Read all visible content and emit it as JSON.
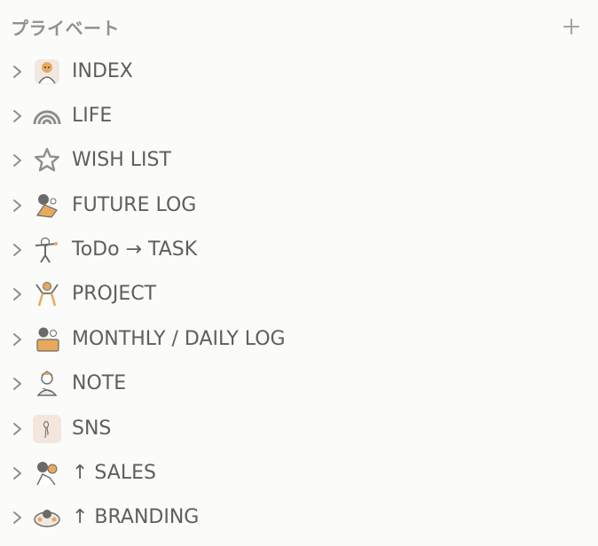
{
  "section": {
    "title": "プライベート",
    "add_icon": "plus-icon"
  },
  "pages": [
    {
      "label": "INDEX",
      "icon": "character-sticker-icon"
    },
    {
      "label": "LIFE",
      "icon": "rainbow-icon"
    },
    {
      "label": "WISH LIST",
      "icon": "star-outline-icon"
    },
    {
      "label": "FUTURE LOG",
      "icon": "character-sticker-icon"
    },
    {
      "label": "ToDo → TASK",
      "icon": "character-sticker-icon"
    },
    {
      "label": "PROJECT",
      "icon": "character-sticker-icon"
    },
    {
      "label": "MONTHLY / DAILY LOG",
      "icon": "character-sticker-icon"
    },
    {
      "label": "NOTE",
      "icon": "character-sticker-icon"
    },
    {
      "label": "SNS",
      "icon": "sketch-card-icon"
    },
    {
      "label": "↑ SALES",
      "icon": "character-sticker-icon"
    },
    {
      "label": "↑ BRANDING",
      "icon": "character-sticker-icon"
    }
  ],
  "colors": {
    "background": "#fbfbfa",
    "text": "#5f5e5b",
    "muted": "#91918e",
    "icon_accent": "#e8a95c"
  }
}
